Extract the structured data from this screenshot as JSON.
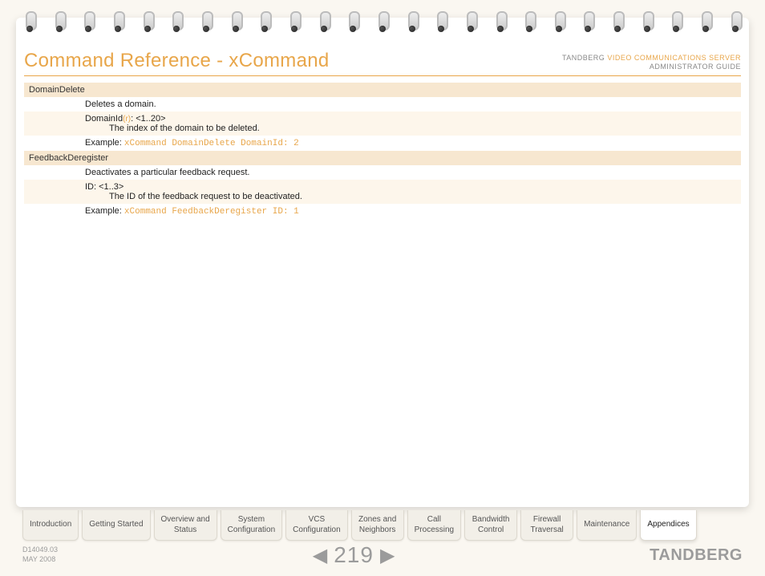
{
  "header": {
    "title": "Command Reference - xCommand",
    "brand": "TANDBERG",
    "product": "VIDEO COMMUNICATIONS SERVER",
    "guide": "ADMINISTRATOR GUIDE"
  },
  "commands": [
    {
      "name": "DomainDelete",
      "desc": "Deletes a domain.",
      "param_label": "DomainId",
      "param_req": "(r)",
      "param_range": ": <1..20>",
      "param_desc": "The index of the domain to be deleted.",
      "example_label": "Example:",
      "example_code": "xCommand DomainDelete DomainId: 2"
    },
    {
      "name": "FeedbackDeregister",
      "desc": "Deactivates a particular feedback request.",
      "param_label": "ID",
      "param_req": "",
      "param_range": ": <1..3>",
      "param_desc": "The ID of the feedback request to be deactivated.",
      "example_label": "Example:",
      "example_code": "xCommand FeedbackDeregister ID: 1"
    }
  ],
  "tabs": [
    {
      "line1": "Introduction",
      "line2": ""
    },
    {
      "line1": "Getting Started",
      "line2": ""
    },
    {
      "line1": "Overview and",
      "line2": "Status"
    },
    {
      "line1": "System",
      "line2": "Configuration"
    },
    {
      "line1": "VCS",
      "line2": "Configuration"
    },
    {
      "line1": "Zones and",
      "line2": "Neighbors"
    },
    {
      "line1": "Call",
      "line2": "Processing"
    },
    {
      "line1": "Bandwidth",
      "line2": "Control"
    },
    {
      "line1": "Firewall",
      "line2": "Traversal"
    },
    {
      "line1": "Maintenance",
      "line2": ""
    },
    {
      "line1": "Appendices",
      "line2": ""
    }
  ],
  "active_tab_index": 10,
  "footer": {
    "doc_id": "D14049.03",
    "doc_date": "MAY 2008",
    "page_number": "219",
    "brand": "TANDBERG"
  },
  "ring_count": 25
}
